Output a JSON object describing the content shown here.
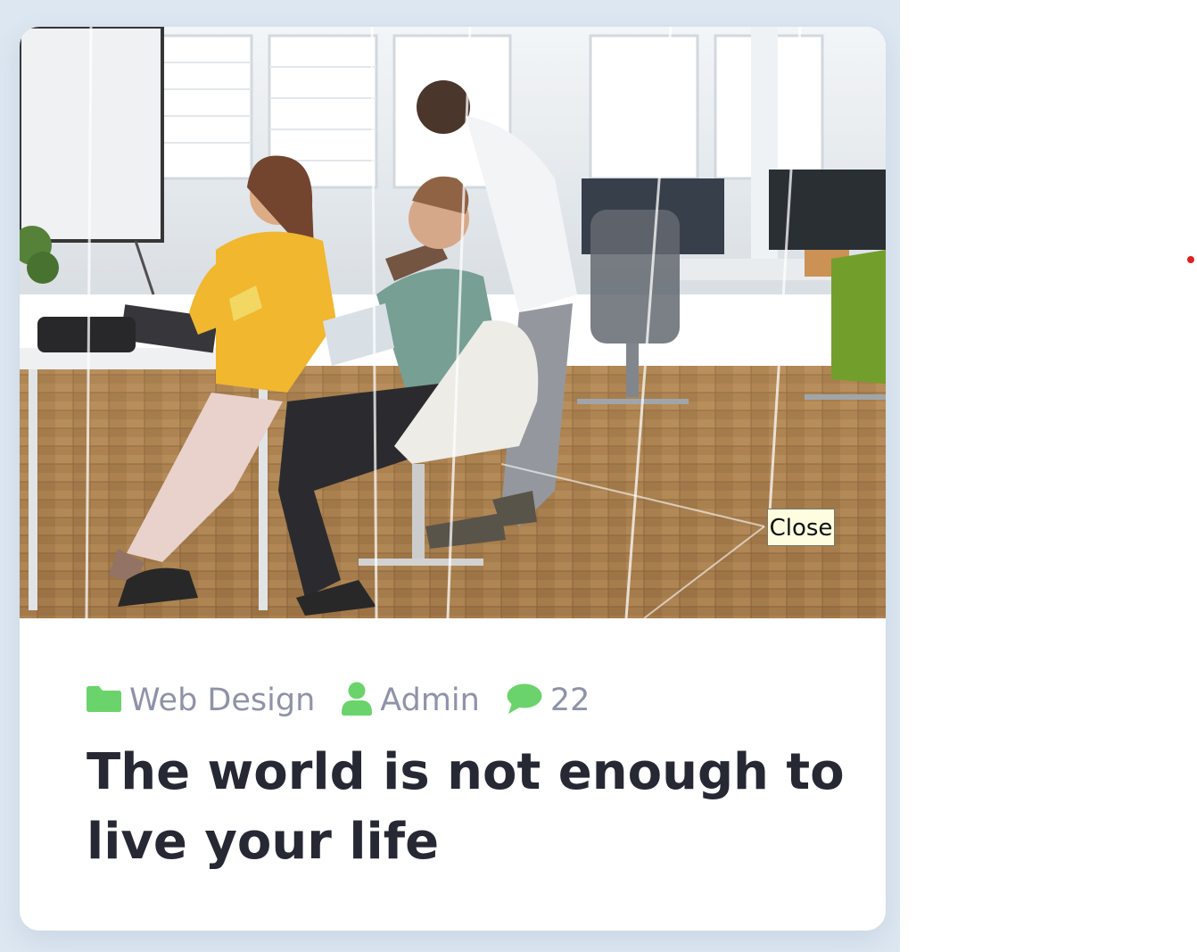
{
  "card": {
    "image_alt": "People working in a modern glass-walled office",
    "close_label": "Close",
    "meta": {
      "category": "Web Design",
      "author": "Admin",
      "comments": "22"
    },
    "title": "The world is not enough to live your life"
  },
  "colors": {
    "accent_icon": "#6bd36b",
    "meta_text": "#8f93a8",
    "title_text": "#262833",
    "page_background": "#dde7f1"
  },
  "icons": {
    "category": "folder-icon",
    "author": "user-icon",
    "comments": "comment-bubble-icon"
  }
}
